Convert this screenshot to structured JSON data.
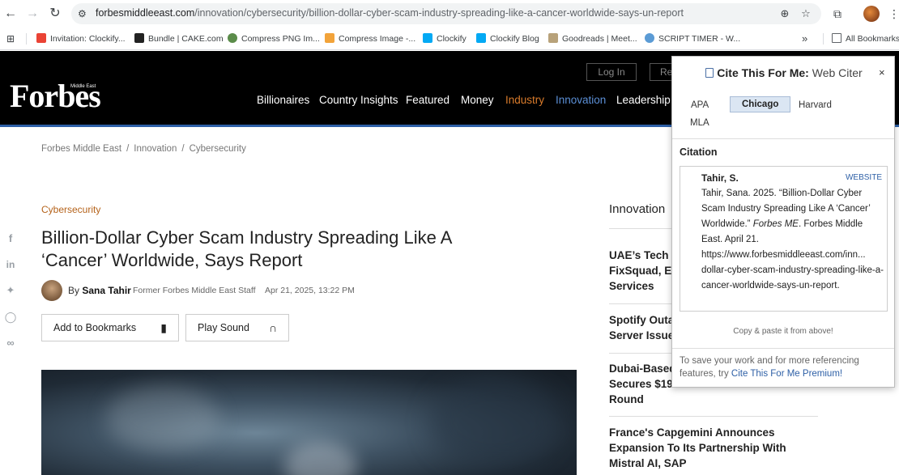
{
  "browser": {
    "url_host": "forbesmiddleeast.com",
    "url_path": "/innovation/cybersecurity/billion-dollar-cyber-scam-industry-spreading-like-a-cancer-worldwide-says-un-report",
    "bookmarks": [
      {
        "label": "Invitation: Clockify...",
        "icon": "gmail-icon",
        "color": "#ea4335"
      },
      {
        "label": "Bundle | CAKE.com",
        "icon": "cake-icon",
        "color": "#222222"
      },
      {
        "label": "Compress PNG Im...",
        "icon": "panda-icon",
        "color": "#5b8c4a"
      },
      {
        "label": "Compress Image -...",
        "icon": "compress-icon",
        "color": "#f2a33a"
      },
      {
        "label": "Clockify",
        "icon": "clockify-icon",
        "color": "#03a9f4"
      },
      {
        "label": "Clockify Blog",
        "icon": "clockify-icon",
        "color": "#03a9f4"
      },
      {
        "label": "Goodreads | Meet...",
        "icon": "goodreads-icon",
        "color": "#b8a27a"
      },
      {
        "label": "SCRIPT TIMER - W...",
        "icon": "timer-icon",
        "color": "#5b9bd5"
      }
    ],
    "more_label": "»",
    "all_bookmarks": "All Bookmarks"
  },
  "site": {
    "logo": "Forbes",
    "logo_sub": "Middle East",
    "login": "Log In",
    "register": "Re",
    "nav": [
      {
        "label": "Billionaires",
        "color": "#ffffff"
      },
      {
        "label": "Country Insights",
        "color": "#ffffff"
      },
      {
        "label": "Featured",
        "color": "#ffffff"
      },
      {
        "label": "Money",
        "color": "#ffffff"
      },
      {
        "label": "Industry",
        "color": "#d97b2b"
      },
      {
        "label": "Innovation",
        "color": "#5b8fd6"
      },
      {
        "label": "Leadership",
        "color": "#ffffff"
      }
    ]
  },
  "article": {
    "breadcrumb": [
      "Forbes Middle East",
      "Innovation",
      "Cybersecurity"
    ],
    "category": "Cybersecurity",
    "headline": "Billion-Dollar Cyber Scam Industry Spreading Like A ‘Cancer’ Worldwide, Says Report",
    "by": "By",
    "author": "Sana Tahir",
    "role": "Former Forbes Middle East Staff",
    "date": "Apr 21, 2025, 13:22 PM",
    "bookmark_btn": "Add to Bookmarks",
    "sound_btn": "Play Sound"
  },
  "sidebar": {
    "title": "Innovation",
    "items": [
      "UAE’s Tech U\nFixSquad, E\nServices",
      "Spotify Outa\nServer Issue",
      "Dubai-Based\nSecures $19\nRound",
      "France's Capgemini Announces\nExpansion To Its Partnership With\nMistral AI, SAP"
    ]
  },
  "cite": {
    "brand": "Cite This For Me:",
    "tool": "Web Citer",
    "close": "×",
    "styles": [
      "APA",
      "Chicago",
      "Harvard",
      "MLA"
    ],
    "active_style": "Chicago",
    "citation_label": "Citation",
    "author": "Tahir, S.",
    "type": "WEBSITE",
    "text_pre": "Tahir, Sana. 2025. “Billion-Dollar Cyber Scam Industry Spreading Like A ‘Cancer’ Worldwide.” ",
    "text_italic": "Forbes ME",
    "text_post": ". Forbes Middle East. April 21. https://www.forbesmiddleeast.com/inn... dollar-cyber-scam-industry-spreading-like-a-cancer-worldwide-says-un-report.",
    "hint": "Copy & paste it from above!",
    "footer_pre": "To save your work and for more referencing features, try ",
    "footer_link": "Cite This For Me Premium!"
  }
}
